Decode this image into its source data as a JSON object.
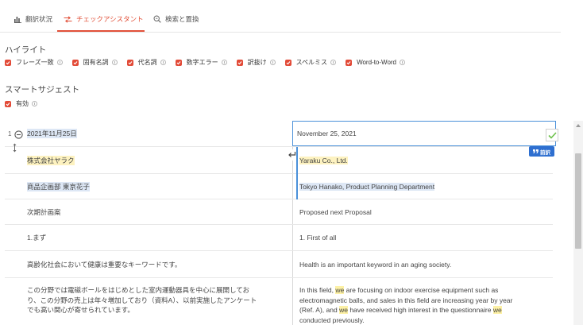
{
  "tabs": [
    {
      "label": "翻訳状況",
      "icon": "bar-chart-icon"
    },
    {
      "label": "チェックアシスタント",
      "icon": "swap-check-icon",
      "active": true
    },
    {
      "label": "検索と置換",
      "icon": "search-replace-icon"
    }
  ],
  "highlight": {
    "title": "ハイライト",
    "options": [
      {
        "label": "フレーズ一致"
      },
      {
        "label": "固有名詞"
      },
      {
        "label": "代名詞"
      },
      {
        "label": "数字エラー"
      },
      {
        "label": "訳抜け"
      },
      {
        "label": "スペルミス"
      },
      {
        "label": "Word-to-Word"
      }
    ]
  },
  "smart_suggest": {
    "title": "スマートサジェスト",
    "option_label": "有効"
  },
  "colors": {
    "accent": "#e2513a",
    "selection_border": "#4a90d9",
    "tm_badge": "#2e6fd0",
    "check_green": "#6cc04a"
  },
  "segments": [
    {
      "number": "1",
      "source": "2021年11月25日",
      "target": "November 25, 2021",
      "badge": "前訳"
    },
    {
      "source": "株式会社ヤラク",
      "target": "Yaraku Co., Ltd."
    },
    {
      "source": "商品企画部 東京花子",
      "target": "Tokyo Hanako, Product Planning Department"
    },
    {
      "source": "次期計画案",
      "target": "Proposed next Proposal"
    },
    {
      "source": "1.まず",
      "target": "1. First of all"
    },
    {
      "source": "高齢化社会において健康は重要なキーワードです。",
      "target": "Health is an important keyword in an aging society."
    },
    {
      "source": "この分野では電磁ボールをはじめとした室内運動器具を中心に展開しており、この分野の売上は年々増加しており（資料A）、以前実施したアンケートでも高い関心が寄せられています。",
      "target_parts": [
        "In this field, ",
        "we",
        " are focusing on indoor exercise equipment such as electromagnetic balls, and sales in this field are increasing year by year (Ref. A), and ",
        "we",
        " have received high interest in the questionnaire ",
        "we",
        " conducted previously."
      ]
    }
  ]
}
